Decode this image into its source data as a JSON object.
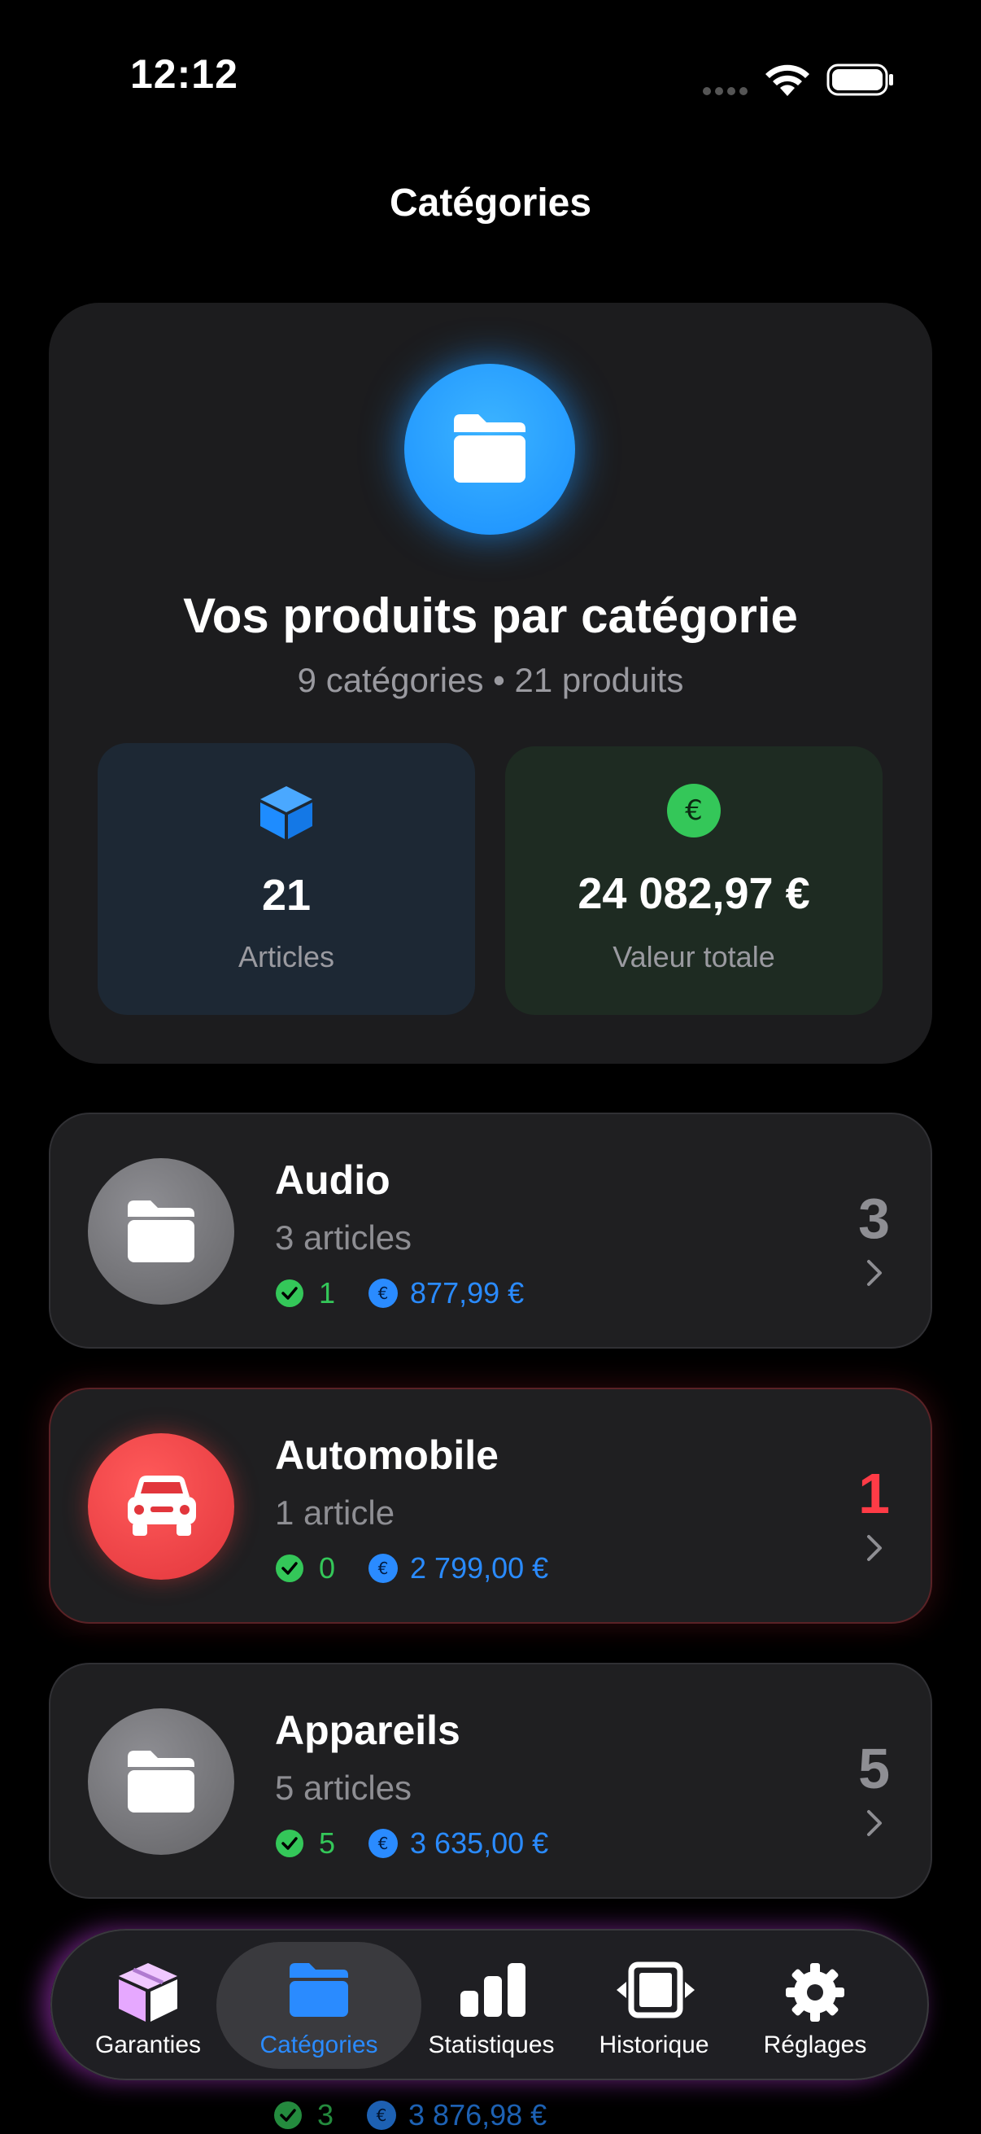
{
  "status": {
    "time": "12:12"
  },
  "nav": {
    "title": "Catégories"
  },
  "summary": {
    "title": "Vos produits par catégorie",
    "subtitle": "9 catégories • 21 produits",
    "articles": {
      "value": "21",
      "label": "Articles"
    },
    "total": {
      "value": "24 082,97 €",
      "label": "Valeur totale"
    }
  },
  "categories": [
    {
      "name": "Audio",
      "count_text": "3 articles",
      "active": "1",
      "value": "877,99 €",
      "number": "3",
      "color": "#636366"
    },
    {
      "name": "Automobile",
      "count_text": "1 article",
      "active": "0",
      "value": "2 799,00 €",
      "number": "1",
      "color": "#ff3b46"
    },
    {
      "name": "Appareils",
      "count_text": "5 articles",
      "active": "5",
      "value": "3 635,00 €",
      "number": "5",
      "color": "#636366"
    }
  ],
  "peek": {
    "active": "3",
    "value": "3 876,98 €"
  },
  "tabs": [
    {
      "label": "Garanties",
      "icon": "box-icon"
    },
    {
      "label": "Catégories",
      "icon": "folder-icon",
      "active": true
    },
    {
      "label": "Statistiques",
      "icon": "bar-chart-icon"
    },
    {
      "label": "Historique",
      "icon": "history-icon"
    },
    {
      "label": "Réglages",
      "icon": "gear-icon"
    }
  ],
  "colors": {
    "accent": "#2a8bff",
    "green": "#34c759",
    "red": "#ff3b46"
  }
}
